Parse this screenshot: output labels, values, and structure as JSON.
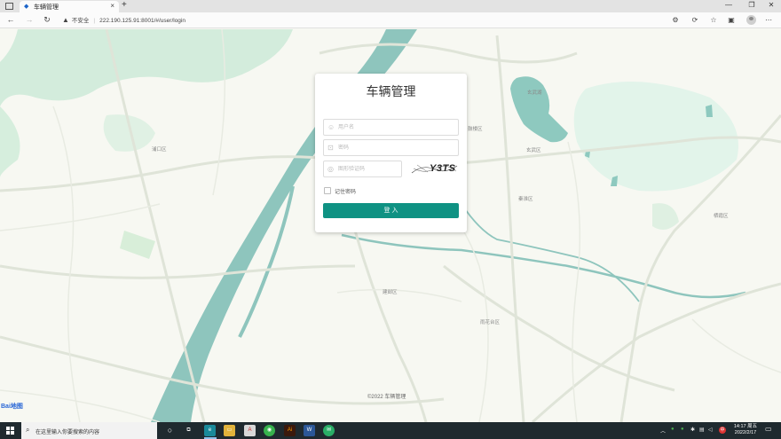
{
  "browser": {
    "tab_title": "车辆管理",
    "tab_close": "×",
    "new_tab": "+",
    "security_label": "不安全",
    "url": "222.190.125.91:8001/#/user/login",
    "window_controls": [
      "—",
      "❐",
      "✕"
    ]
  },
  "map": {
    "labels": [
      {
        "text": "浦口区"
      },
      {
        "text": "鼓楼区"
      },
      {
        "text": "玄武区"
      },
      {
        "text": "秦淮区"
      },
      {
        "text": "建邺区"
      },
      {
        "text": "雨花台区"
      },
      {
        "text": "玄武湖"
      },
      {
        "text": "栖霞区"
      }
    ],
    "logo_text": "Bai地图",
    "copyright": "©2022 车辆管理"
  },
  "login": {
    "title": "车辆管理",
    "username_placeholder": "用户名",
    "password_placeholder": "密码",
    "captcha_placeholder": "图形验证码",
    "captcha_text": "Y3TS",
    "remember_label": "记住密码",
    "submit_label": "登 入",
    "accent_color": "#0f9283"
  },
  "taskbar": {
    "search_placeholder": "在这里输入你要搜索的内容",
    "tray_language": "中",
    "time": "14:17 周五",
    "date": "2022/2/17"
  }
}
